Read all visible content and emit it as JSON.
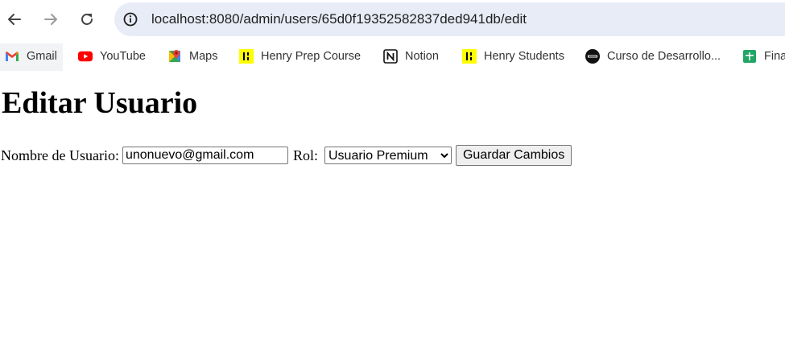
{
  "browser": {
    "url": "localhost:8080/admin/users/65d0f19352582837ded941db/edit",
    "bookmarks": [
      {
        "label": "Gmail",
        "icon": "gmail-icon"
      },
      {
        "label": "YouTube",
        "icon": "youtube-icon"
      },
      {
        "label": "Maps",
        "icon": "maps-icon"
      },
      {
        "label": "Henry Prep Course",
        "icon": "henry-icon"
      },
      {
        "label": "Notion",
        "icon": "notion-icon"
      },
      {
        "label": "Henry Students",
        "icon": "henry-icon"
      },
      {
        "label": "Curso de Desarrollo...",
        "icon": "coder-icon"
      },
      {
        "label": "Fina",
        "icon": "sheets-icon"
      }
    ]
  },
  "page": {
    "title": "Editar Usuario",
    "form": {
      "username_label": "Nombre de Usuario:",
      "username_value": "unonuevo@gmail.com",
      "role_label": "Rol:",
      "role_selected": "Usuario Premium",
      "submit_label": "Guardar Cambios"
    }
  },
  "colors": {
    "url_bar_bg": "#e8ecf7",
    "henry_yellow": "#ffff01",
    "youtube_red": "#ff0000",
    "sheets_green": "#23a566"
  }
}
